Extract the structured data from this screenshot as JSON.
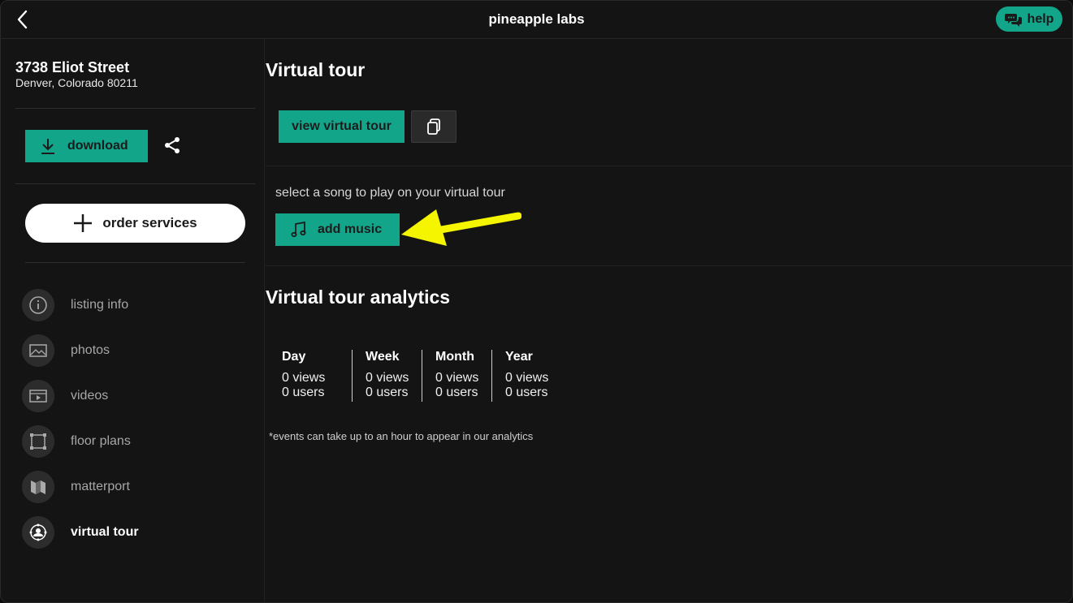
{
  "app": {
    "title": "pineapple labs",
    "help_label": "help"
  },
  "sidebar": {
    "address_line1": "3738 Eliot Street",
    "address_line2": "Denver, Colorado 80211",
    "download_label": "download",
    "order_label": "order services",
    "items": [
      {
        "label": "listing info",
        "icon": "info-icon"
      },
      {
        "label": "photos",
        "icon": "image-icon"
      },
      {
        "label": "videos",
        "icon": "video-icon"
      },
      {
        "label": "floor plans",
        "icon": "floor-plan-icon"
      },
      {
        "label": "matterport",
        "icon": "matterport-icon"
      },
      {
        "label": "virtual tour",
        "icon": "virtual-tour-icon",
        "active": true
      }
    ]
  },
  "main": {
    "tour_title": "Virtual tour",
    "view_tour_label": "view virtual tour",
    "song_prompt": "select a song to play on your virtual tour",
    "add_music_label": "add music",
    "analytics_title": "Virtual tour analytics",
    "analytics": [
      {
        "period": "Day",
        "views": "0 views",
        "users": "0 users"
      },
      {
        "period": "Week",
        "views": "0 views",
        "users": "0 users"
      },
      {
        "period": "Month",
        "views": "0 views",
        "users": "0 users"
      },
      {
        "period": "Year",
        "views": "0 views",
        "users": "0 users"
      }
    ],
    "note": "*events can take up to an hour to appear in our analytics"
  },
  "colors": {
    "accent": "#12a58a",
    "background": "#141414",
    "annotation_arrow": "#f5f500"
  }
}
